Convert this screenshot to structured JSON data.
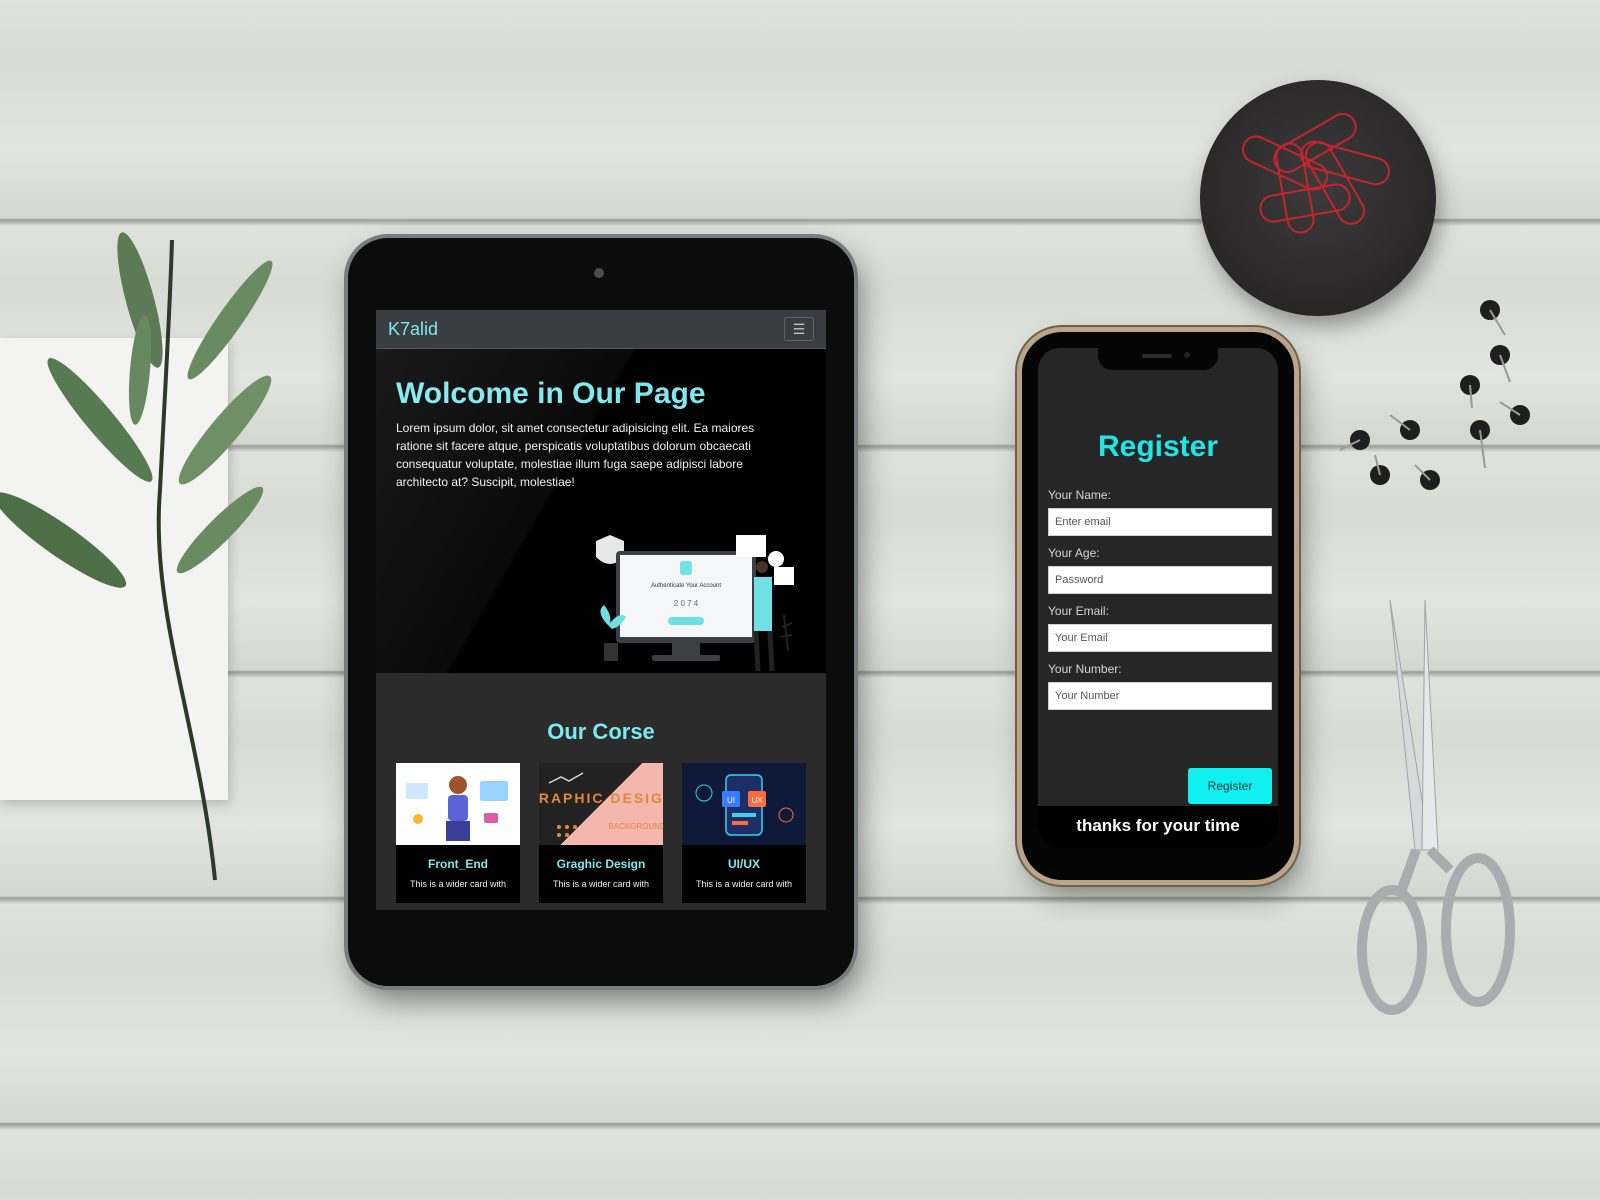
{
  "tablet_site": {
    "brand": "K7alid",
    "hero": {
      "title": "Wolcome in Our Page",
      "body": "Lorem ipsum dolor, sit amet consectetur adipisicing elit. Ea maiores ratione sit facere atque, perspicatis voluptatibus dolorum obcaecati consequatur voluptate, molestiae illum fuga saepe adipisci labore architecto at? Suscipit, molestiae!",
      "illustration_caption": "Authenticate Your Account",
      "illustration_code": "2 0 7 4"
    },
    "courses": {
      "heading": "Our Corse",
      "items": [
        {
          "title": "Front_End",
          "text": "This is a wider card with"
        },
        {
          "title": "Graghic Design",
          "text": "This is a wider card with",
          "thumb_text": "GRAPHIC DESIGN",
          "thumb_subtext": "BACKGROUND"
        },
        {
          "title": "UI/UX",
          "text": "This is a wider card with",
          "thumb_left": "UI",
          "thumb_right": "UX"
        }
      ]
    }
  },
  "phone_site": {
    "title": "Register",
    "fields": [
      {
        "label": "Your Name:",
        "placeholder": "Enter email"
      },
      {
        "label": "Your Age:",
        "placeholder": "Password"
      },
      {
        "label": "Your Email:",
        "placeholder": "Your Email"
      },
      {
        "label": "Your Number:",
        "placeholder": "Your Number"
      }
    ],
    "submit_label": "Register",
    "footer": "thanks for your time"
  },
  "colors": {
    "accent": "#7ee8ef",
    "button": "#10f0f0",
    "dark": "#000000",
    "section": "#2b2b2b"
  },
  "icons": {
    "menu": "hamburger-icon"
  }
}
